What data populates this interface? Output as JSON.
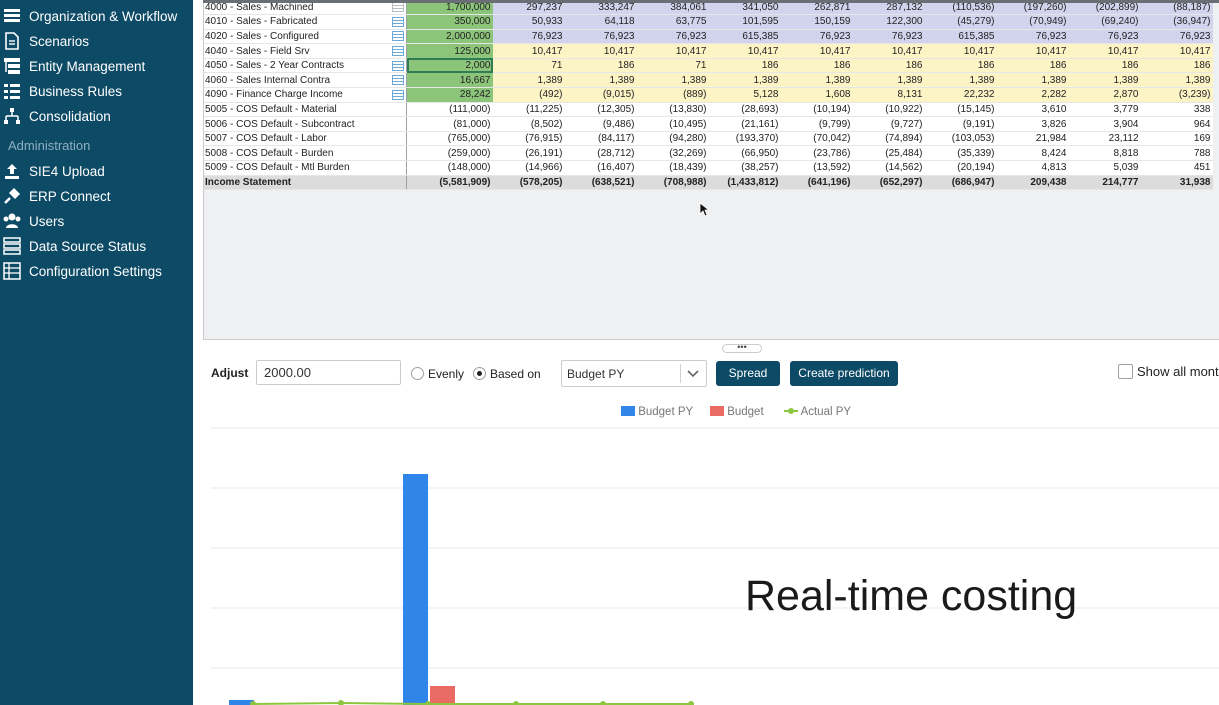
{
  "sidebar": {
    "items": [
      {
        "label": "Organization & Workflow",
        "icon": "workflow-icon"
      },
      {
        "label": "Scenarios",
        "icon": "document-icon"
      },
      {
        "label": "Entity Management",
        "icon": "hierarchy-icon"
      },
      {
        "label": "Business Rules",
        "icon": "list-icon"
      },
      {
        "label": "Consolidation",
        "icon": "org-chart-icon"
      }
    ],
    "section_header": "Administration",
    "admin_items": [
      {
        "label": "SIE4 Upload",
        "icon": "upload-icon"
      },
      {
        "label": "ERP Connect",
        "icon": "plug-icon"
      },
      {
        "label": "Users",
        "icon": "users-icon"
      },
      {
        "label": "Data Source Status",
        "icon": "server-icon"
      },
      {
        "label": "Configuration Settings",
        "icon": "settings-list-icon"
      }
    ]
  },
  "grid": {
    "rows": [
      {
        "name": "4000 - Sales - Machined",
        "style": "blue",
        "values": [
          "1,700,000",
          "297,237",
          "333,247",
          "384,061",
          "341,050",
          "262,871",
          "287,132",
          "(110,536)",
          "(197,260)",
          "(202,899)",
          "(88,187)"
        ]
      },
      {
        "name": "4010 - Sales - Fabricated",
        "style": "blue",
        "values": [
          "350,000",
          "50,933",
          "64,118",
          "63,775",
          "101,595",
          "150,159",
          "122,300",
          "(45,279)",
          "(70,949)",
          "(69,240)",
          "(36,947)"
        ]
      },
      {
        "name": "4020 - Sales - Configured",
        "style": "blue",
        "values": [
          "2,000,000",
          "76,923",
          "76,923",
          "76,923",
          "615,385",
          "76,923",
          "76,923",
          "615,385",
          "76,923",
          "76,923",
          "76,923"
        ]
      },
      {
        "name": "4040 - Sales - Field Srv",
        "style": "yellow",
        "values": [
          "125,000",
          "10,417",
          "10,417",
          "10,417",
          "10,417",
          "10,417",
          "10,417",
          "10,417",
          "10,417",
          "10,417",
          "10,417"
        ]
      },
      {
        "name": "4050 - Sales - 2 Year Contracts",
        "style": "yellow",
        "values": [
          "2,000",
          "71",
          "186",
          "71",
          "186",
          "186",
          "186",
          "186",
          "186",
          "186",
          "186"
        ]
      },
      {
        "name": "4060 - Sales Internal Contra",
        "style": "yellow",
        "values": [
          "16,667",
          "1,389",
          "1,389",
          "1,389",
          "1,389",
          "1,389",
          "1,389",
          "1,389",
          "1,389",
          "1,389",
          "1,389"
        ]
      },
      {
        "name": "4090 - Finance Charge Income",
        "style": "yellow",
        "values": [
          "28,242",
          "(492)",
          "(9,015)",
          "(889)",
          "5,128",
          "1,608",
          "8,131",
          "22,232",
          "2,282",
          "2,870",
          "(3,239)"
        ]
      },
      {
        "name": "5005 - COS Default - Material",
        "style": "plain",
        "values": [
          "(111,000)",
          "(11,225)",
          "(12,305)",
          "(13,830)",
          "(28,693)",
          "(10,194)",
          "(10,922)",
          "(15,145)",
          "3,610",
          "3,779",
          "338"
        ]
      },
      {
        "name": "5006 - COS Default - Subcontract",
        "style": "plain",
        "values": [
          "(81,000)",
          "(8,502)",
          "(9,486)",
          "(10,495)",
          "(21,161)",
          "(9,799)",
          "(9,727)",
          "(9,191)",
          "3,826",
          "3,904",
          "964"
        ]
      },
      {
        "name": "5007 - COS Default - Labor",
        "style": "plain",
        "values": [
          "(765,000)",
          "(76,915)",
          "(84,117)",
          "(94,280)",
          "(193,370)",
          "(70,042)",
          "(74,894)",
          "(103,053)",
          "21,984",
          "23,112",
          "169"
        ]
      },
      {
        "name": "5008 - COS Default - Burden",
        "style": "plain",
        "values": [
          "(259,000)",
          "(26,191)",
          "(28,712)",
          "(32,269)",
          "(66,950)",
          "(23,786)",
          "(25,484)",
          "(35,339)",
          "8,424",
          "8,818",
          "788"
        ]
      },
      {
        "name": "5009 - COS Default - Mtl Burden",
        "style": "plain",
        "values": [
          "(148,000)",
          "(14,966)",
          "(16,407)",
          "(18,439)",
          "(38,257)",
          "(13,592)",
          "(14,562)",
          "(20,194)",
          "4,813",
          "5,039",
          "451"
        ]
      },
      {
        "name": "Income Statement",
        "style": "total",
        "values": [
          "(5,581,909)",
          "(578,205)",
          "(638,521)",
          "(708,988)",
          "(1,433,812)",
          "(641,196)",
          "(652,297)",
          "(686,947)",
          "209,438",
          "214,777",
          "31,938"
        ]
      }
    ]
  },
  "toolbar": {
    "adjust_label": "Adjust",
    "adjust_value": "2000.00",
    "evenly_label": "Evenly",
    "based_on_label": "Based on",
    "based_on_selected": "Budget PY",
    "spread_label": "Spread",
    "create_prediction_label": "Create prediction",
    "show_all_label": "Show all mont"
  },
  "chart_data": {
    "type": "bar",
    "series": [
      {
        "name": "Budget PY",
        "color": "#2f86e8"
      },
      {
        "name": "Budget",
        "color": "#ea6b63"
      },
      {
        "name": "Actual PY",
        "color": "#8cc63f"
      }
    ]
  },
  "caption": "Real-time costing"
}
